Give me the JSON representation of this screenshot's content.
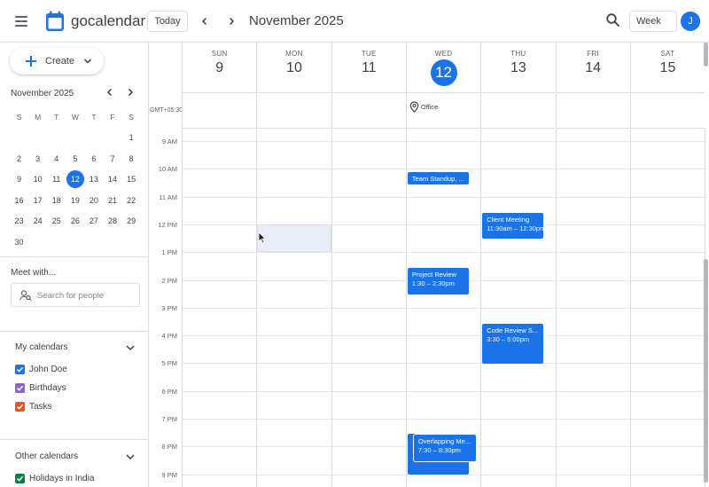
{
  "header": {
    "app_title": "gocalendar",
    "today_label": "Today",
    "month_title": "November 2025",
    "view_label": "Week",
    "avatar_initial": "J"
  },
  "sidebar": {
    "create_label": "Create",
    "mini_title": "November 2025",
    "weekday_initials": [
      "S",
      "M",
      "T",
      "W",
      "T",
      "F",
      "S"
    ],
    "weeks": [
      [
        "",
        "",
        "",
        "",
        "",
        "",
        "1"
      ],
      [
        "2",
        "3",
        "4",
        "5",
        "6",
        "7",
        "8"
      ],
      [
        "9",
        "10",
        "11",
        "12",
        "13",
        "14",
        "15"
      ],
      [
        "16",
        "17",
        "18",
        "19",
        "20",
        "21",
        "22"
      ],
      [
        "23",
        "24",
        "25",
        "26",
        "27",
        "28",
        "29"
      ],
      [
        "30",
        "",
        "",
        "",
        "",
        "",
        ""
      ]
    ],
    "today_date": "12",
    "meet_title": "Meet with...",
    "people_placeholder": "Search for people",
    "my_calendars_title": "My calendars",
    "my_calendars": [
      {
        "label": "John Doe",
        "color": "#1a73e8"
      },
      {
        "label": "Birthdays",
        "color": "#8e63ce"
      },
      {
        "label": "Tasks",
        "color": "#e8541e"
      }
    ],
    "other_calendars_title": "Other calendars",
    "other_calendars": [
      {
        "label": "Holidays in India",
        "color": "#0b8043"
      }
    ]
  },
  "week": {
    "timezone": "GMT+05:30",
    "days": [
      {
        "name": "SUN",
        "num": "9"
      },
      {
        "name": "MON",
        "num": "10"
      },
      {
        "name": "TUE",
        "num": "11"
      },
      {
        "name": "WED",
        "num": "12",
        "today": true
      },
      {
        "name": "THU",
        "num": "13"
      },
      {
        "name": "FRI",
        "num": "14"
      },
      {
        "name": "SAT",
        "num": "15"
      }
    ],
    "working_location": {
      "day_index": 3,
      "label": "Office"
    },
    "hours": [
      "9 AM",
      "10 AM",
      "11 AM",
      "12 PM",
      "1 PM",
      "2 PM",
      "3 PM",
      "4 PM",
      "5 PM",
      "6 PM",
      "7 PM",
      "8 PM",
      "9 PM"
    ]
  },
  "events": [
    {
      "title": "Team Standup, ...",
      "time": "",
      "day_index": 3,
      "start": 10.1,
      "end": 10.6
    },
    {
      "title": "Client Meeting",
      "time": "11:30am – 12:30pm",
      "day_index": 4,
      "start": 11.55,
      "end": 12.55
    },
    {
      "title": "Project Review",
      "time": "1:30 – 2:30pm",
      "day_index": 3,
      "start": 1.55,
      "end": 2.55
    },
    {
      "title": "Code Review S...",
      "time": "3:30 – 5:00pm",
      "day_index": 4,
      "start": 3.55,
      "end": 5.05
    },
    {
      "title": "Overlapping Me...",
      "time": "7:30 – 8:30pm",
      "day_index": 3,
      "start": 7.55,
      "end": 8.55
    },
    {
      "title": "",
      "time": "",
      "day_index": 3,
      "start": 7.5,
      "end": 9.05
    }
  ],
  "colors": {
    "accent": "#1a73e8",
    "grid": "#dadce0"
  }
}
